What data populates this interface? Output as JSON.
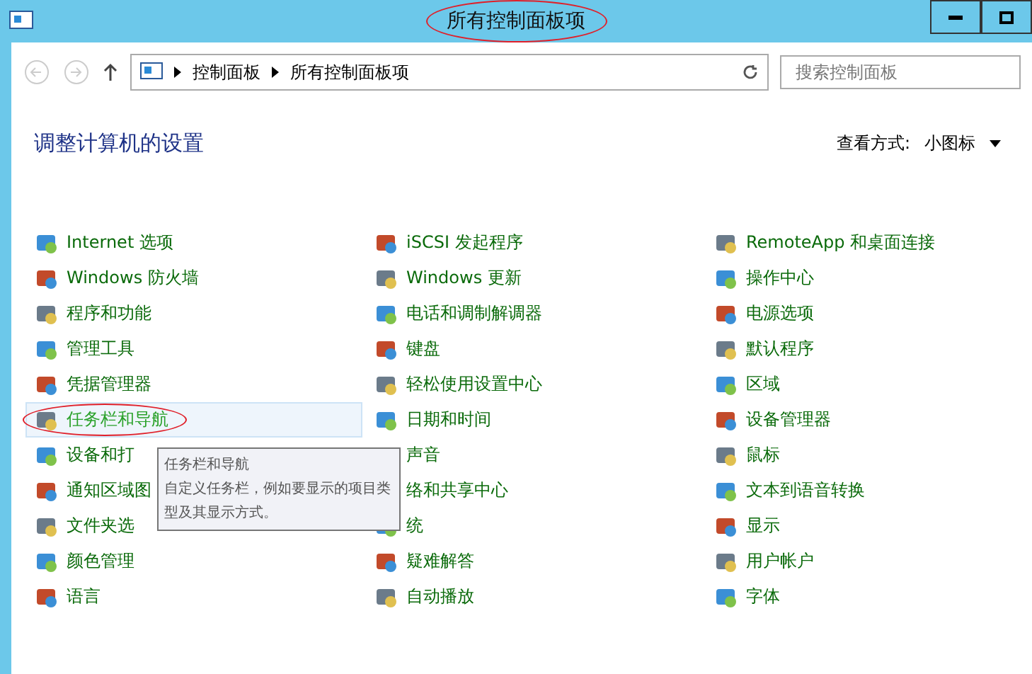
{
  "window": {
    "title": "所有控制面板项",
    "title_circled": true
  },
  "address": {
    "crumbs": [
      "控制面板",
      "所有控制面板项"
    ]
  },
  "search": {
    "placeholder": "搜索控制面板"
  },
  "heading": "调整计算机的设置",
  "view": {
    "label": "查看方式:",
    "value": "小图标"
  },
  "columns": [
    [
      {
        "label": "Internet 选项",
        "highlighted": false,
        "circled": false
      },
      {
        "label": "Windows 防火墙",
        "highlighted": false,
        "circled": false
      },
      {
        "label": "程序和功能",
        "highlighted": false,
        "circled": false
      },
      {
        "label": "管理工具",
        "highlighted": false,
        "circled": false
      },
      {
        "label": "凭据管理器",
        "highlighted": false,
        "circled": false
      },
      {
        "label": "任务栏和导航",
        "highlighted": true,
        "circled": true
      },
      {
        "label": "设备和打",
        "highlighted": false,
        "circled": false
      },
      {
        "label": "通知区域图",
        "highlighted": false,
        "circled": false
      },
      {
        "label": "文件夹选",
        "highlighted": false,
        "circled": false
      },
      {
        "label": "颜色管理",
        "highlighted": false,
        "circled": false
      },
      {
        "label": "语言",
        "highlighted": false,
        "circled": false
      }
    ],
    [
      {
        "label": "iSCSI 发起程序",
        "highlighted": false,
        "circled": false
      },
      {
        "label": "Windows 更新",
        "highlighted": false,
        "circled": false
      },
      {
        "label": "电话和调制解调器",
        "highlighted": false,
        "circled": false
      },
      {
        "label": "键盘",
        "highlighted": false,
        "circled": false
      },
      {
        "label": "轻松使用设置中心",
        "highlighted": false,
        "circled": false
      },
      {
        "label": "日期和时间",
        "highlighted": false,
        "circled": false
      },
      {
        "label": "声音",
        "highlighted": false,
        "circled": false
      },
      {
        "label": "络和共享中心",
        "highlighted": false,
        "circled": false
      },
      {
        "label": "统",
        "highlighted": false,
        "circled": false
      },
      {
        "label": "疑难解答",
        "highlighted": false,
        "circled": false
      },
      {
        "label": "自动播放",
        "highlighted": false,
        "circled": false
      }
    ],
    [
      {
        "label": "RemoteApp 和桌面连接",
        "highlighted": false,
        "circled": false
      },
      {
        "label": "操作中心",
        "highlighted": false,
        "circled": false
      },
      {
        "label": "电源选项",
        "highlighted": false,
        "circled": false
      },
      {
        "label": "默认程序",
        "highlighted": false,
        "circled": false
      },
      {
        "label": "区域",
        "highlighted": false,
        "circled": false
      },
      {
        "label": "设备管理器",
        "highlighted": false,
        "circled": false
      },
      {
        "label": "鼠标",
        "highlighted": false,
        "circled": false
      },
      {
        "label": "文本到语音转换",
        "highlighted": false,
        "circled": false
      },
      {
        "label": "显示",
        "highlighted": false,
        "circled": false
      },
      {
        "label": "用户帐户",
        "highlighted": false,
        "circled": false
      },
      {
        "label": "字体",
        "highlighted": false,
        "circled": false
      }
    ]
  ],
  "tooltip": {
    "title": "任务栏和导航",
    "text": "自定义任务栏，例如要显示的项目类型及其显示方式。"
  }
}
